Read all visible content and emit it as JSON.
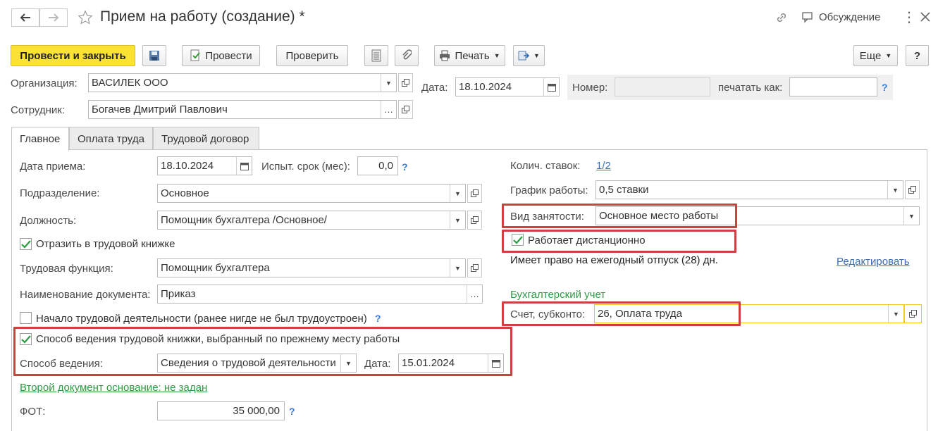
{
  "window": {
    "title": "Прием на работу (создание) *",
    "discussion_label": "Обсуждение"
  },
  "toolbar": {
    "post_close": "Провести и закрыть",
    "post": "Провести",
    "check": "Проверить",
    "print": "Печать",
    "more": "Еще",
    "help": "?"
  },
  "header": {
    "org_label": "Организация:",
    "org_value": "ВАСИЛЕК ООО",
    "date_label": "Дата:",
    "date_value": "18.10.2024",
    "number_label": "Номер:",
    "number_value": "",
    "print_as_label": "печатать как:",
    "print_as_value": "",
    "employee_label": "Сотрудник:",
    "employee_value": "Богачев Дмитрий Павлович"
  },
  "tabs": [
    "Главное",
    "Оплата труда",
    "Трудовой договор"
  ],
  "main": {
    "hire_date_label": "Дата приема:",
    "hire_date_value": "18.10.2024",
    "probation_label": "Испыт. срок (мес):",
    "probation_value": "0,0",
    "department_label": "Подразделение:",
    "department_value": "Основное",
    "position_label": "Должность:",
    "position_value": "Помощник бухгалтера /Основное/",
    "reflect_label": "Отразить в трудовой книжке",
    "reflect_checked": true,
    "function_label": "Трудовая функция:",
    "function_value": "Помощник бухгалтера",
    "docname_label": "Наименование документа:",
    "docname_value": "Приказ",
    "start_label": "Начало трудовой деятельности (ранее нигде не был трудоустроен)",
    "start_checked": false,
    "method_checkbox_label": "Способ ведения трудовой книжки, выбранный по прежнему месту работы",
    "method_checked": true,
    "method_label": "Способ ведения:",
    "method_value": "Сведения о трудовой деятельности",
    "method_date_label": "Дата:",
    "method_date_value": "15.01.2024",
    "second_doc_link": "Второй документ основание: не задан",
    "fot_label": "ФОТ:",
    "fot_value": "35 000,00"
  },
  "right": {
    "rates_label": "Колич. ставок:",
    "rates_value": "1/2",
    "schedule_label": "График работы:",
    "schedule_value": "0,5 ставки",
    "employment_label": "Вид занятости:",
    "employment_value": "Основное место работы",
    "remote_label": "Работает дистанционно",
    "remote_checked": true,
    "vacation_text": "Имеет право на ежегодный отпуск (28) дн.",
    "edit_link": "Редактировать",
    "accounting_header": "Бухгалтерский учет",
    "account_label": "Счет, субконто:",
    "account_value": "26, Оплата труда"
  },
  "colors": {
    "primary_button": "#fbe233",
    "highlight_box": "#c9423f",
    "link_green": "#2e9a44",
    "link_blue": "#3a6fb5",
    "focus_border": "#f2c81d",
    "help_blue": "#3a7bd5"
  }
}
